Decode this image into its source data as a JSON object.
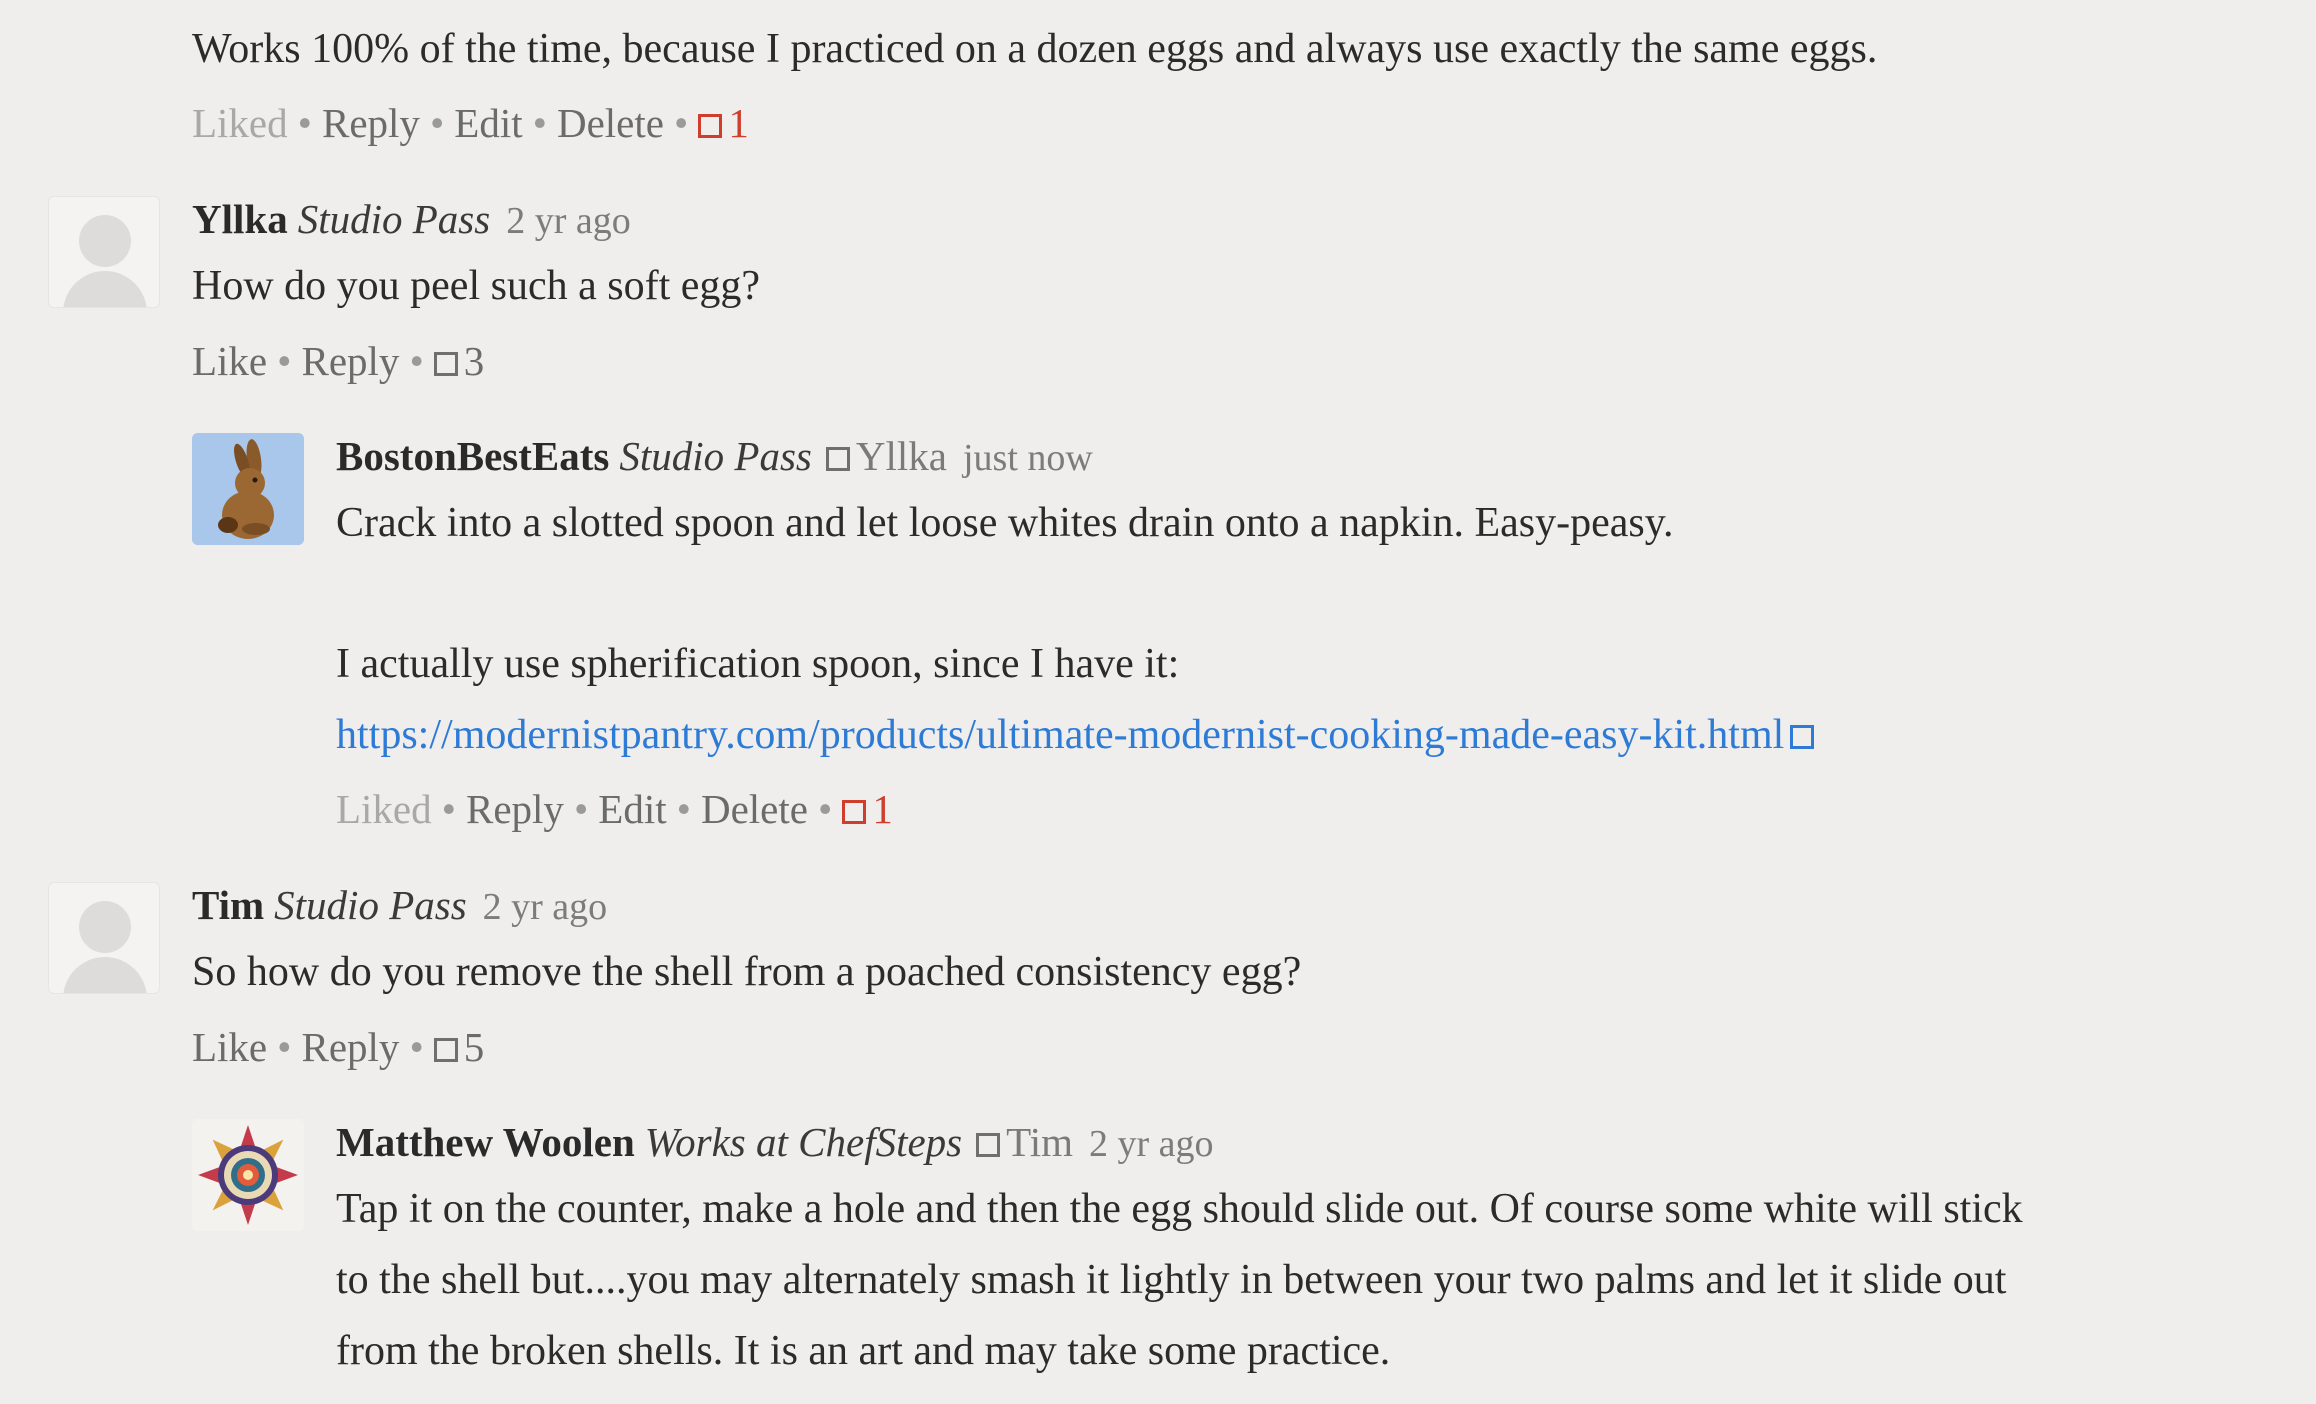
{
  "comments": {
    "top": {
      "text": "Works 100% of the time, because I practiced on a dozen eggs and always use exactly the same eggs.",
      "actions": {
        "liked": "Liked",
        "reply": "Reply",
        "edit": "Edit",
        "delete": "Delete",
        "comment_count": "1"
      }
    },
    "yllka": {
      "author": "Yllka",
      "badge": "Studio Pass",
      "time": "2 yr ago",
      "text": "How do you peel such a soft egg?",
      "actions": {
        "like": "Like",
        "reply": "Reply",
        "comment_count": "3"
      }
    },
    "boston": {
      "author": "BostonBestEats",
      "badge": "Studio Pass",
      "reply_to": "Yllka",
      "time": "just now",
      "text_line1": "Crack into a slotted spoon and let loose whites drain onto a napkin.  Easy-peasy.",
      "text_line2": "I actually use spherification spoon, since I have it:",
      "link": "https://modernistpantry.com/products/ultimate-modernist-cooking-made-easy-kit.html",
      "actions": {
        "liked": "Liked",
        "reply": "Reply",
        "edit": "Edit",
        "delete": "Delete",
        "comment_count": "1"
      }
    },
    "tim": {
      "author": "Tim",
      "badge": "Studio Pass",
      "time": "2 yr ago",
      "text": "So how do you remove the shell from a poached consistency egg?",
      "actions": {
        "like": "Like",
        "reply": "Reply",
        "comment_count": "5"
      }
    },
    "matthew": {
      "author": "Matthew Woolen",
      "badge": "Works at ChefSteps",
      "reply_to": "Tim",
      "time": "2 yr ago",
      "text_line1": "Tap it on the counter, make a hole and then the egg should slide out. Of course some white will stick",
      "text_line2": "to the shell but....you may alternately smash it lightly in between your two palms and let it slide out",
      "text_line3": "from the broken shells. It is an art and may take some practice."
    }
  },
  "separator": "•",
  "colors": {
    "background": "#efeeed",
    "link": "#2e7bd6",
    "liked_count": "#cf3d2d"
  },
  "icons": {
    "comment": "comment-box-icon",
    "reply_to": "reply-arrow-icon",
    "external_link": "external-link-icon"
  }
}
